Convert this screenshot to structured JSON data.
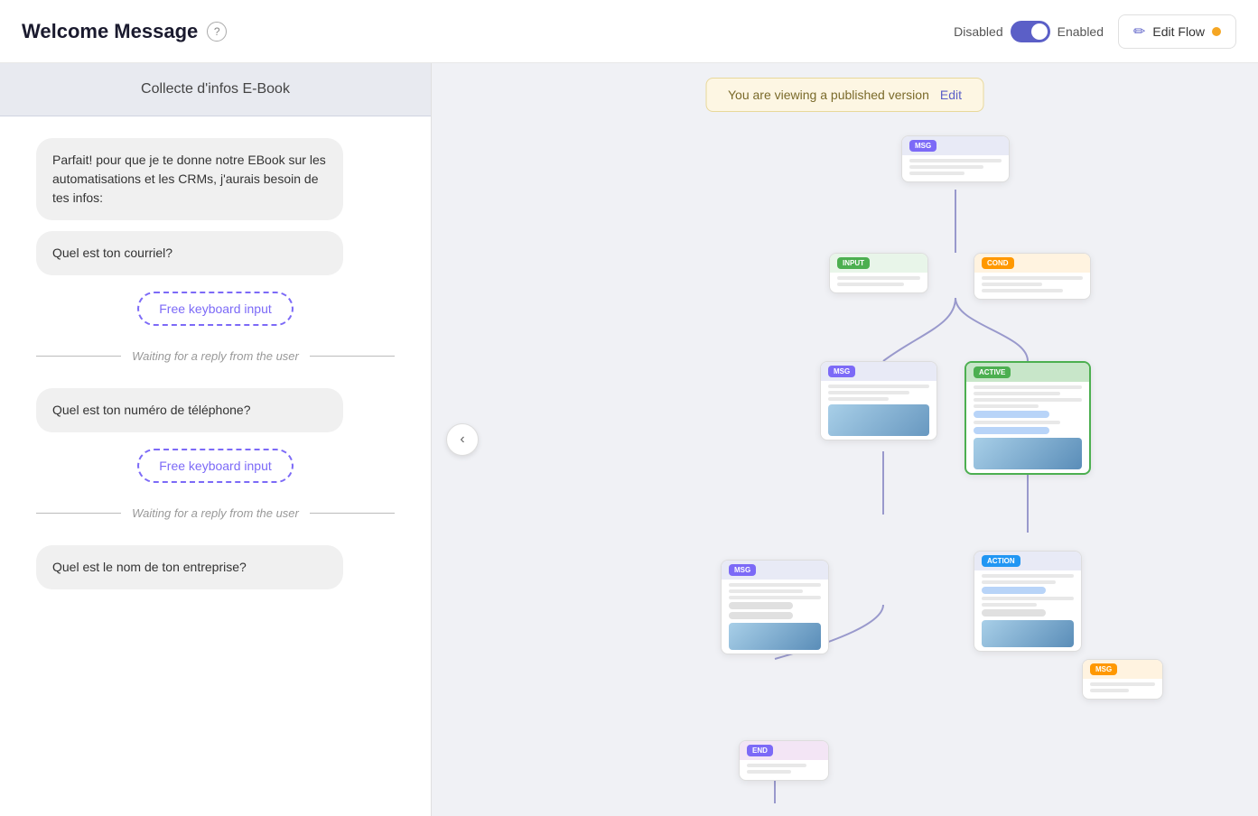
{
  "header": {
    "title": "Welcome Message",
    "help_tooltip": "Help",
    "toggle_disabled_label": "Disabled",
    "toggle_enabled_label": "Enabled",
    "edit_flow_label": "Edit Flow",
    "status_color": "#f5a623"
  },
  "left_panel": {
    "panel_title": "Collecte d'infos E-Book",
    "messages": [
      {
        "id": "msg1",
        "text": "Parfait! pour que je te donne notre EBook sur les automatisations et les CRMs, j'aurais besoin de tes infos:",
        "type": "bubble"
      },
      {
        "id": "msg2",
        "text": "Quel est ton courriel?",
        "type": "bubble"
      },
      {
        "id": "input1",
        "text": "Free keyboard input",
        "type": "keyboard_input"
      },
      {
        "id": "wait1",
        "text": "Waiting for a reply from the user",
        "type": "waiting"
      },
      {
        "id": "msg3",
        "text": "Quel est ton numéro de téléphone?",
        "type": "bubble"
      },
      {
        "id": "input2",
        "text": "Free keyboard input",
        "type": "keyboard_input"
      },
      {
        "id": "wait2",
        "text": "Waiting for a reply from the user",
        "type": "waiting"
      },
      {
        "id": "msg4",
        "text": "Quel est le nom de ton entreprise?",
        "type": "bubble"
      }
    ]
  },
  "canvas": {
    "published_banner": "You are viewing a published version",
    "edit_link": "Edit",
    "collapse_icon": "‹"
  }
}
